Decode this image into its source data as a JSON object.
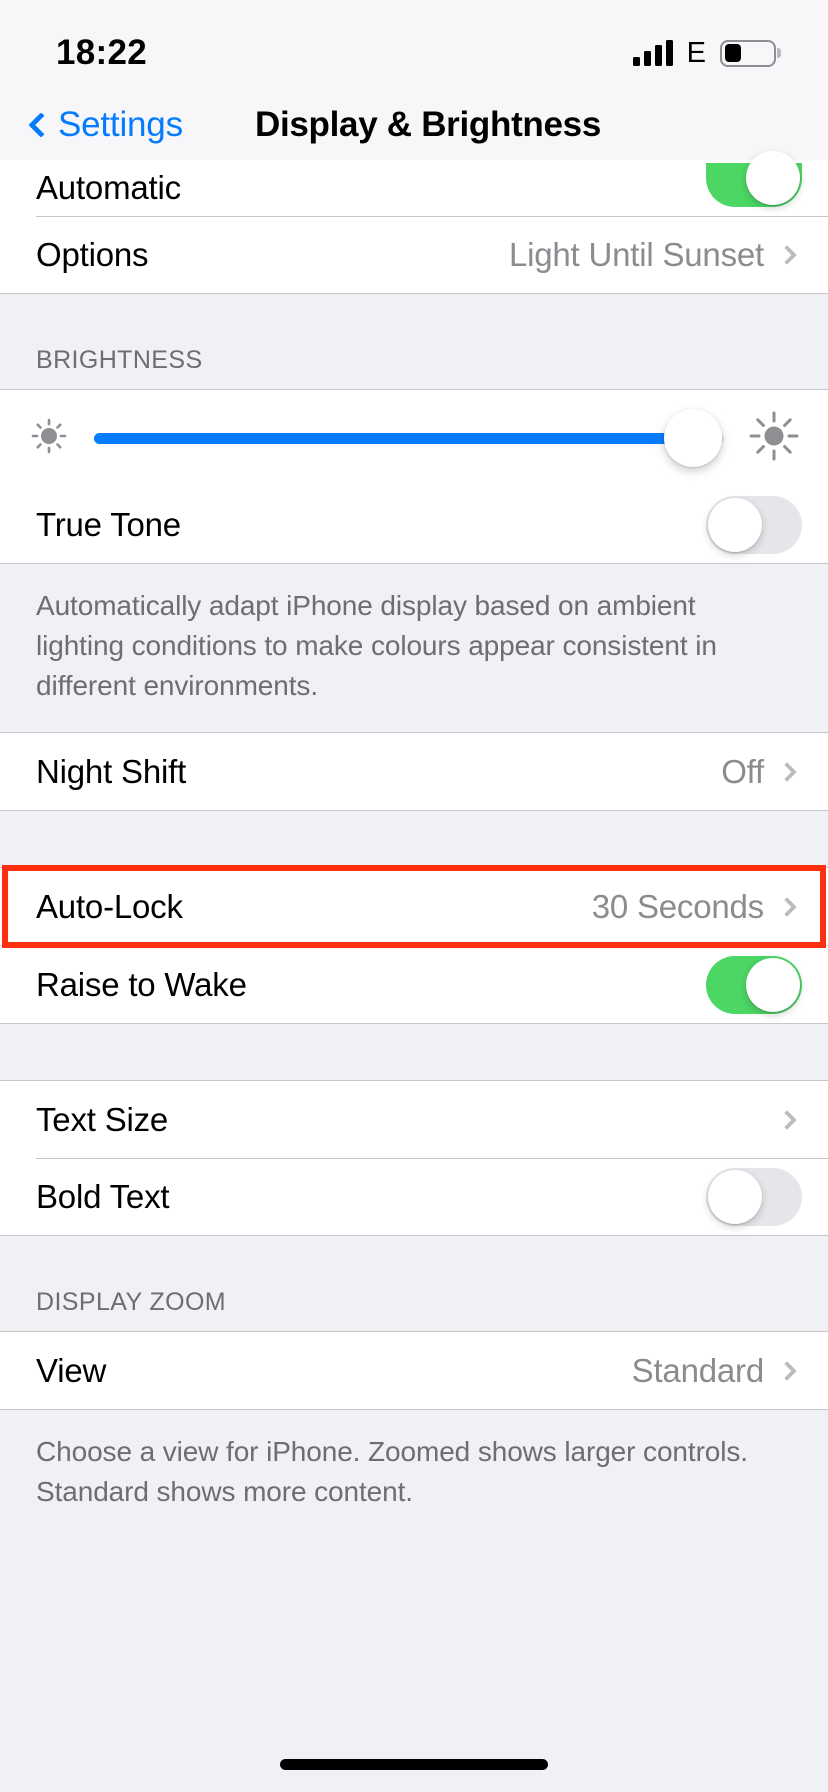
{
  "status_bar": {
    "time": "18:22",
    "signal_bars": 4,
    "network_type": "E",
    "battery_percent": 35
  },
  "nav": {
    "back_label": "Settings",
    "title": "Display & Brightness"
  },
  "appearance_section": {
    "automatic": {
      "label": "Automatic",
      "toggle_on": true
    },
    "options": {
      "label": "Options",
      "value": "Light Until Sunset"
    }
  },
  "brightness_section": {
    "header": "BRIGHTNESS",
    "slider": {
      "name": "brightness-slider",
      "value_percent": 95,
      "min_icon": "sun-small-icon",
      "max_icon": "sun-large-icon"
    },
    "true_tone": {
      "label": "True Tone",
      "toggle_on": false
    },
    "footer": "Automatically adapt iPhone display based on ambient lighting conditions to make colours appear consistent in different environments."
  },
  "night_shift_section": {
    "night_shift": {
      "label": "Night Shift",
      "value": "Off"
    }
  },
  "lock_section": {
    "auto_lock": {
      "label": "Auto-Lock",
      "value": "30 Seconds",
      "highlighted": true
    },
    "raise_to_wake": {
      "label": "Raise to Wake",
      "toggle_on": true
    }
  },
  "text_section": {
    "text_size": {
      "label": "Text Size"
    },
    "bold_text": {
      "label": "Bold Text",
      "toggle_on": false
    }
  },
  "display_zoom_section": {
    "header": "DISPLAY ZOOM",
    "view": {
      "label": "View",
      "value": "Standard"
    },
    "footer": "Choose a view for iPhone. Zoomed shows larger controls. Standard shows more content."
  },
  "colors": {
    "accent_blue": "#067cfd",
    "toggle_green": "#4cd663",
    "highlight_red": "#fd2f11",
    "value_gray": "#8b8b90",
    "group_bg": "#eff1f5"
  }
}
